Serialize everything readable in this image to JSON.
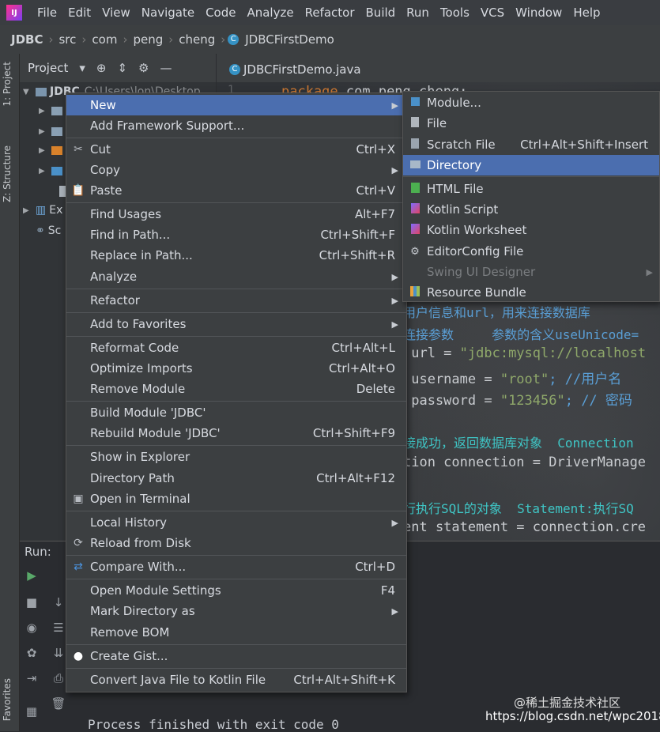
{
  "menubar": [
    "File",
    "Edit",
    "View",
    "Navigate",
    "Code",
    "Analyze",
    "Refactor",
    "Build",
    "Run",
    "Tools",
    "VCS",
    "Window",
    "Help"
  ],
  "logo_text": "IJ",
  "breadcrumb": [
    "JDBC",
    "src",
    "com",
    "peng",
    "cheng",
    "JDBCFirstDemo"
  ],
  "left_tabs": {
    "project": "1: Project",
    "structure": "Z: Structure",
    "favorites": "Favorites"
  },
  "project_panel": {
    "title": "Project",
    "root": "JDBC",
    "root_path": "C:\\Users\\lon\\Desktop",
    "ext_label": "Ex",
    "scratch_label": "Sc"
  },
  "editor": {
    "tab": "JDBCFirstDemo.java",
    "line_number": "1",
    "package_kw": "package",
    "package_name": " com.peng.cheng;",
    "comment1": "用户信息和url，用来连接数据库",
    "comment2": "连接参数     参数的含义useUnicode=",
    "url_line_a": " url = ",
    "url_line_b": "\"jdbc:mysql://localhost",
    "user_line_a": " username = ",
    "user_line_b": "\"root\"",
    "user_line_c": "; //用户名",
    "pass_line_a": " password = ",
    "pass_line_b": "\"123456\"",
    "pass_line_c": "; // 密码",
    "comment3": "接成功，返回数据库对象  Connection",
    "conn_line": "tion connection = DriverManage",
    "comment4": "行执行SQL的对象  Statement:执行SQ",
    "stmt_line": "ent statement = connection.cre"
  },
  "run": {
    "label": "Run:",
    "output": "Process finished with exit code 0"
  },
  "watermark": {
    "line1": "@稀土掘金技术社区",
    "line2": "https://blog.csdn.net/wpc2018"
  },
  "context_menu": [
    {
      "label": "New",
      "shortcut": "",
      "arrow": true,
      "selected": true,
      "icon": ""
    },
    {
      "label": "Add Framework Support...",
      "shortcut": "",
      "arrow": false,
      "icon": ""
    },
    {
      "label": "Cut",
      "shortcut": "Ctrl+X",
      "arrow": false,
      "icon": "scissors-icon"
    },
    {
      "label": "Copy",
      "shortcut": "",
      "arrow": true,
      "icon": ""
    },
    {
      "label": "Paste",
      "shortcut": "Ctrl+V",
      "arrow": false,
      "icon": "clipboard-icon"
    },
    {
      "label": "Find Usages",
      "shortcut": "Alt+F7",
      "arrow": false,
      "icon": ""
    },
    {
      "label": "Find in Path...",
      "shortcut": "Ctrl+Shift+F",
      "arrow": false,
      "icon": ""
    },
    {
      "label": "Replace in Path...",
      "shortcut": "Ctrl+Shift+R",
      "arrow": false,
      "icon": ""
    },
    {
      "label": "Analyze",
      "shortcut": "",
      "arrow": true,
      "icon": ""
    },
    {
      "label": "Refactor",
      "shortcut": "",
      "arrow": true,
      "icon": ""
    },
    {
      "label": "Add to Favorites",
      "shortcut": "",
      "arrow": true,
      "icon": ""
    },
    {
      "label": "Reformat Code",
      "shortcut": "Ctrl+Alt+L",
      "arrow": false,
      "icon": ""
    },
    {
      "label": "Optimize Imports",
      "shortcut": "Ctrl+Alt+O",
      "arrow": false,
      "icon": ""
    },
    {
      "label": "Remove Module",
      "shortcut": "Delete",
      "arrow": false,
      "icon": ""
    },
    {
      "label": "Build Module 'JDBC'",
      "shortcut": "",
      "arrow": false,
      "icon": ""
    },
    {
      "label": "Rebuild Module 'JDBC'",
      "shortcut": "Ctrl+Shift+F9",
      "arrow": false,
      "icon": ""
    },
    {
      "label": "Show in Explorer",
      "shortcut": "",
      "arrow": false,
      "icon": ""
    },
    {
      "label": "Directory Path",
      "shortcut": "Ctrl+Alt+F12",
      "arrow": false,
      "icon": ""
    },
    {
      "label": "Open in Terminal",
      "shortcut": "",
      "arrow": false,
      "icon": "terminal-icon"
    },
    {
      "label": "Local History",
      "shortcut": "",
      "arrow": true,
      "icon": ""
    },
    {
      "label": "Reload from Disk",
      "shortcut": "",
      "arrow": false,
      "icon": "reload-icon"
    },
    {
      "label": "Compare With...",
      "shortcut": "Ctrl+D",
      "arrow": false,
      "icon": "compare-icon"
    },
    {
      "label": "Open Module Settings",
      "shortcut": "F4",
      "arrow": false,
      "icon": ""
    },
    {
      "label": "Mark Directory as",
      "shortcut": "",
      "arrow": true,
      "icon": ""
    },
    {
      "label": "Remove BOM",
      "shortcut": "",
      "arrow": false,
      "icon": ""
    },
    {
      "label": "Create Gist...",
      "shortcut": "",
      "arrow": false,
      "icon": "github-icon"
    },
    {
      "label": "Convert Java File to Kotlin File",
      "shortcut": "Ctrl+Alt+Shift+K",
      "arrow": false,
      "icon": ""
    }
  ],
  "submenu": [
    {
      "label": "Module...",
      "shortcut": "",
      "icon": "module-icon"
    },
    {
      "label": "File",
      "shortcut": "",
      "icon": "file-icon"
    },
    {
      "label": "Scratch File",
      "shortcut": "Ctrl+Alt+Shift+Insert",
      "icon": "scratch-file-icon"
    },
    {
      "label": "Directory",
      "shortcut": "",
      "icon": "folder-icon",
      "selected": true
    },
    {
      "label": "HTML File",
      "shortcut": "",
      "icon": "html-file-icon"
    },
    {
      "label": "Kotlin Script",
      "shortcut": "",
      "icon": "kotlin-icon"
    },
    {
      "label": "Kotlin Worksheet",
      "shortcut": "",
      "icon": "kotlin-icon"
    },
    {
      "label": "EditorConfig File",
      "shortcut": "",
      "icon": "gear-icon"
    },
    {
      "label": "Swing UI Designer",
      "shortcut": "",
      "icon": "",
      "disabled": true,
      "arrow": true
    },
    {
      "label": "Resource Bundle",
      "shortcut": "",
      "icon": "resource-bundle-icon"
    }
  ],
  "colors": {
    "selection": "#4b6eaf",
    "menu_bg": "#3c3f41",
    "keyword": "#cc7832",
    "string": "#8fa86a",
    "comment": "#5a9fd6"
  }
}
